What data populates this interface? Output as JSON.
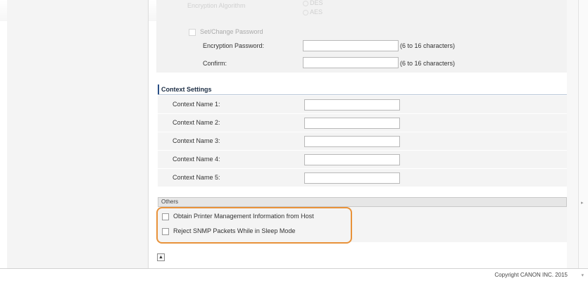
{
  "encryption": {
    "faded_label": "Encryption Algorithm",
    "faded_option_top": "DES",
    "faded_option": "AES",
    "set_change_password_label": "Set/Change Password",
    "encryption_password_label": "Encryption Password:",
    "encryption_password_value": "",
    "encryption_password_hint": "(6 to 16 characters)",
    "confirm_label": "Confirm:",
    "confirm_value": "",
    "confirm_hint": "(6 to 16 characters)"
  },
  "context_settings": {
    "title": "Context Settings",
    "rows": [
      {
        "label": "Context Name 1:",
        "value": ""
      },
      {
        "label": "Context Name 2:",
        "value": ""
      },
      {
        "label": "Context Name 3:",
        "value": ""
      },
      {
        "label": "Context Name 4:",
        "value": ""
      },
      {
        "label": "Context Name 5:",
        "value": ""
      }
    ]
  },
  "others": {
    "title": "Others",
    "options": [
      {
        "label": "Obtain Printer Management Information from Host",
        "checked": false
      },
      {
        "label": "Reject SNMP Packets While in Sleep Mode",
        "checked": false
      }
    ]
  },
  "top_button_icon": "to-top-icon",
  "footer": {
    "copyright": "Copyright CANON INC. 2015"
  },
  "colors": {
    "highlight": "#e8923a",
    "section_bar": "#2a4f86"
  }
}
